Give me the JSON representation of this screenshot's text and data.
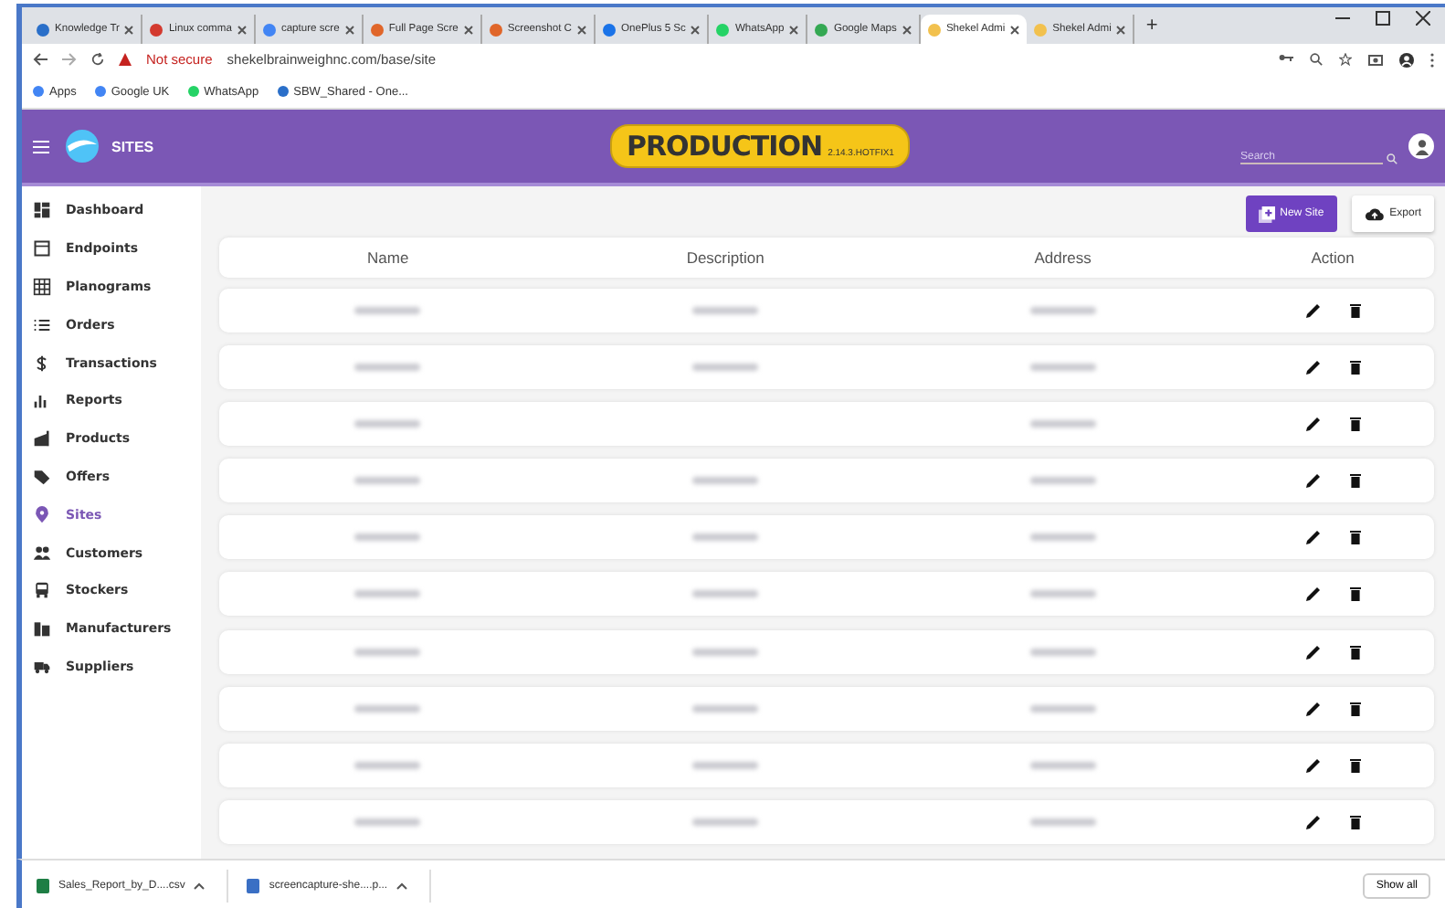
{
  "browser": {
    "tabs": [
      {
        "label": "Knowledge Tr",
        "color": "#2a6fc9",
        "selected": false
      },
      {
        "label": "Linux comma",
        "color": "#d33a2f",
        "selected": false
      },
      {
        "label": "capture scre",
        "color": "#4285f4",
        "selected": false
      },
      {
        "label": "Full Page Scre",
        "color": "#e0662a",
        "selected": false
      },
      {
        "label": "Screenshot C",
        "color": "#e0662a",
        "selected": false
      },
      {
        "label": "OnePlus 5 Sc",
        "color": "#1a73e8",
        "selected": false
      },
      {
        "label": "WhatsApp",
        "color": "#25d366",
        "selected": false
      },
      {
        "label": "Google Maps",
        "color": "#34a853",
        "selected": false
      },
      {
        "label": "Shekel Admi",
        "color": "#f2c14e",
        "selected": true
      },
      {
        "label": "Shekel Admi",
        "color": "#f2c14e",
        "selected": false
      }
    ],
    "new_tab": "+",
    "security": "Not secure",
    "url": "shekelbrainweighnc.com/base/site",
    "bookmarks": [
      {
        "label": "Apps",
        "color": "#4285f4"
      },
      {
        "label": "Google UK",
        "color": "#4285f4"
      },
      {
        "label": "WhatsApp",
        "color": "#25d366"
      },
      {
        "label": "SBW_Shared - One...",
        "color": "#2a6fc9"
      }
    ]
  },
  "header": {
    "title": "SITES",
    "environment": "PRODUCTION",
    "version": "2.14.3.HOTFIX1",
    "search": {
      "placeholder": "Search"
    }
  },
  "sidebar": {
    "items": [
      {
        "label": "Dashboard",
        "selected": false
      },
      {
        "label": "Endpoints",
        "selected": false
      },
      {
        "label": "Planograms",
        "selected": false
      },
      {
        "label": "Orders",
        "selected": false
      },
      {
        "label": "Transactions",
        "selected": false
      },
      {
        "label": "Reports",
        "selected": false
      },
      {
        "label": "Products",
        "selected": false
      },
      {
        "label": "Offers",
        "selected": false
      },
      {
        "label": "Sites",
        "selected": true
      },
      {
        "label": "Customers",
        "selected": false
      },
      {
        "label": "Stockers",
        "selected": false
      },
      {
        "label": "Manufacturers",
        "selected": false
      },
      {
        "label": "Suppliers",
        "selected": false
      }
    ]
  },
  "toolbar": {
    "buttons": [
      "New Site",
      "Export"
    ]
  },
  "table": {
    "columns": [
      "Name",
      "Description",
      "Address",
      "Action"
    ],
    "rows": [
      {
        "cells": [
          {
            "kind": "blurred"
          },
          {
            "kind": "blurred"
          },
          {
            "kind": "blurred"
          }
        ]
      },
      {
        "cells": [
          {
            "kind": "blurred"
          },
          {
            "kind": "blurred"
          },
          {
            "kind": "blurred"
          }
        ]
      },
      {
        "cells": [
          {
            "kind": "blurred"
          },
          {
            "kind": "empty"
          },
          {
            "kind": "blurred"
          }
        ]
      },
      {
        "cells": [
          {
            "kind": "blurred"
          },
          {
            "kind": "blurred"
          },
          {
            "kind": "blurred"
          }
        ]
      },
      {
        "cells": [
          {
            "kind": "blurred"
          },
          {
            "kind": "blurred"
          },
          {
            "kind": "blurred"
          }
        ]
      },
      {
        "cells": [
          {
            "kind": "blurred"
          },
          {
            "kind": "blurred"
          },
          {
            "kind": "blurred"
          }
        ]
      },
      {
        "cells": [
          {
            "kind": "blurred"
          },
          {
            "kind": "blurred"
          },
          {
            "kind": "blurred"
          }
        ]
      },
      {
        "cells": [
          {
            "kind": "blurred"
          },
          {
            "kind": "blurred"
          },
          {
            "kind": "blurred"
          }
        ]
      },
      {
        "cells": [
          {
            "kind": "blurred"
          },
          {
            "kind": "blurred"
          },
          {
            "kind": "blurred"
          }
        ]
      },
      {
        "cells": [
          {
            "kind": "blurred"
          },
          {
            "kind": "blurred"
          },
          {
            "kind": "blurred"
          }
        ]
      }
    ]
  },
  "downloads": {
    "items": [
      "Sales_Report_by_D....csv",
      "screencapture-she....p..."
    ],
    "show_all": "Show all"
  }
}
